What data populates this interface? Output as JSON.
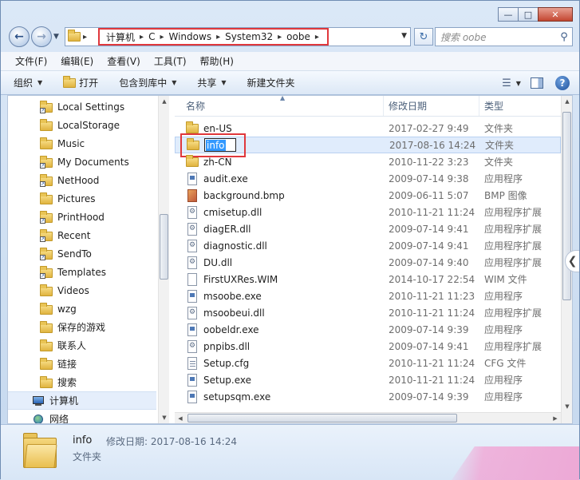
{
  "window": {
    "caption": {
      "minimize": "—",
      "maximize": "□",
      "close": "✕"
    }
  },
  "nav": {
    "breadcrumb": [
      "计算机",
      "C",
      "Windows",
      "System32",
      "oobe"
    ],
    "search_placeholder": "搜索 oobe"
  },
  "menu": [
    "文件(F)",
    "编辑(E)",
    "查看(V)",
    "工具(T)",
    "帮助(H)"
  ],
  "toolbar": {
    "organize": "组织",
    "open": "打开",
    "include_in_library": "包含到库中",
    "share": "共享",
    "new_folder": "新建文件夹"
  },
  "sidebar": {
    "items": [
      {
        "label": "Local Settings",
        "icon": "shortcut-folder-icon"
      },
      {
        "label": "LocalStorage",
        "icon": "folder-icon"
      },
      {
        "label": "Music",
        "icon": "folder-icon"
      },
      {
        "label": "My Documents",
        "icon": "shortcut-folder-icon"
      },
      {
        "label": "NetHood",
        "icon": "shortcut-folder-icon"
      },
      {
        "label": "Pictures",
        "icon": "folder-icon"
      },
      {
        "label": "PrintHood",
        "icon": "shortcut-folder-icon"
      },
      {
        "label": "Recent",
        "icon": "shortcut-folder-icon"
      },
      {
        "label": "SendTo",
        "icon": "shortcut-folder-icon"
      },
      {
        "label": "Templates",
        "icon": "shortcut-folder-icon"
      },
      {
        "label": "Videos",
        "icon": "folder-icon"
      },
      {
        "label": "wzg",
        "icon": "folder-icon"
      },
      {
        "label": "保存的游戏",
        "icon": "folder-icon"
      },
      {
        "label": "联系人",
        "icon": "folder-icon"
      },
      {
        "label": "链接",
        "icon": "folder-icon"
      },
      {
        "label": "搜索",
        "icon": "folder-icon"
      },
      {
        "label": "计算机",
        "icon": "computer-icon"
      },
      {
        "label": "网络",
        "icon": "network-icon"
      }
    ]
  },
  "columns": {
    "name": "名称",
    "date": "修改日期",
    "type": "类型"
  },
  "files": [
    {
      "name": "en-US",
      "date": "2017-02-27 9:49",
      "type": "文件夹",
      "kind": "folder"
    },
    {
      "name": "info",
      "date": "2017-08-16 14:24",
      "type": "文件夹",
      "kind": "folder"
    },
    {
      "name": "zh-CN",
      "date": "2010-11-22 3:23",
      "type": "文件夹",
      "kind": "folder"
    },
    {
      "name": "audit.exe",
      "date": "2009-07-14 9:38",
      "type": "应用程序",
      "kind": "exe"
    },
    {
      "name": "background.bmp",
      "date": "2009-06-11 5:07",
      "type": "BMP 图像",
      "kind": "bmp"
    },
    {
      "name": "cmisetup.dll",
      "date": "2010-11-21 11:24",
      "type": "应用程序扩展",
      "kind": "dll"
    },
    {
      "name": "diagER.dll",
      "date": "2009-07-14 9:41",
      "type": "应用程序扩展",
      "kind": "dll"
    },
    {
      "name": "diagnostic.dll",
      "date": "2009-07-14 9:41",
      "type": "应用程序扩展",
      "kind": "dll"
    },
    {
      "name": "DU.dll",
      "date": "2009-07-14 9:40",
      "type": "应用程序扩展",
      "kind": "dll"
    },
    {
      "name": "FirstUXRes.WIM",
      "date": "2014-10-17 22:54",
      "type": "WIM 文件",
      "kind": "file"
    },
    {
      "name": "msoobe.exe",
      "date": "2010-11-21 11:23",
      "type": "应用程序",
      "kind": "exe"
    },
    {
      "name": "msoobeui.dll",
      "date": "2010-11-21 11:24",
      "type": "应用程序扩展",
      "kind": "dll"
    },
    {
      "name": "oobeldr.exe",
      "date": "2009-07-14 9:39",
      "type": "应用程序",
      "kind": "exe"
    },
    {
      "name": "pnpibs.dll",
      "date": "2009-07-14 9:41",
      "type": "应用程序扩展",
      "kind": "dll"
    },
    {
      "name": "Setup.cfg",
      "date": "2010-11-21 11:24",
      "type": "CFG 文件",
      "kind": "cfg"
    },
    {
      "name": "Setup.exe",
      "date": "2010-11-21 11:24",
      "type": "应用程序",
      "kind": "exe"
    },
    {
      "name": "setupsqm.exe",
      "date": "2009-07-14 9:39",
      "type": "应用程序",
      "kind": "exe"
    }
  ],
  "details": {
    "name": "info",
    "modified_label": "修改日期: 2017-08-16 14:24",
    "type": "文件夹"
  }
}
